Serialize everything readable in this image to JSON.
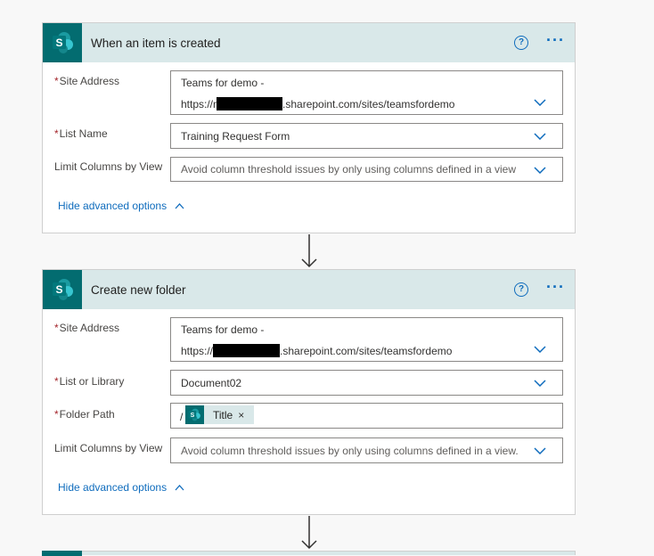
{
  "colors": {
    "header_bg": "#d9e8e9",
    "sharepoint_tile": "#036c70",
    "accent": "#0f6cbd",
    "required": "#a4262c",
    "page_bg": "#f8f8f8"
  },
  "card1": {
    "title": "When an item is created",
    "icon": "sharepoint-icon",
    "help_label": "?",
    "more_label": "···",
    "site_address": {
      "label": "Site Address",
      "required": "*",
      "line1": "Teams for demo -",
      "prefix": "https://r",
      "suffix": ".sharepoint.com/sites/teamsfordemo"
    },
    "list_name": {
      "label": "List Name",
      "required": "*",
      "value": "Training Request Form"
    },
    "limit_columns": {
      "label": "Limit Columns by View",
      "placeholder": "Avoid column threshold issues by only using columns defined in a view"
    },
    "advanced_link": "Hide advanced options"
  },
  "card2": {
    "title": "Create new folder",
    "icon": "sharepoint-icon",
    "help_label": "?",
    "more_label": "···",
    "site_address": {
      "label": "Site Address",
      "required": "*",
      "line1": "Teams for demo -",
      "prefix": "https://",
      "suffix": ".sharepoint.com/sites/teamsfordemo"
    },
    "list_or_library": {
      "label": "List or Library",
      "required": "*",
      "value": "Document02"
    },
    "folder_path": {
      "label": "Folder Path",
      "required": "*",
      "prefix": "/",
      "token_label": "Title",
      "token_remove": "×"
    },
    "limit_columns": {
      "label": "Limit Columns by View",
      "placeholder": "Avoid column threshold issues by only using columns defined in a view."
    },
    "advanced_link": "Hide advanced options"
  }
}
